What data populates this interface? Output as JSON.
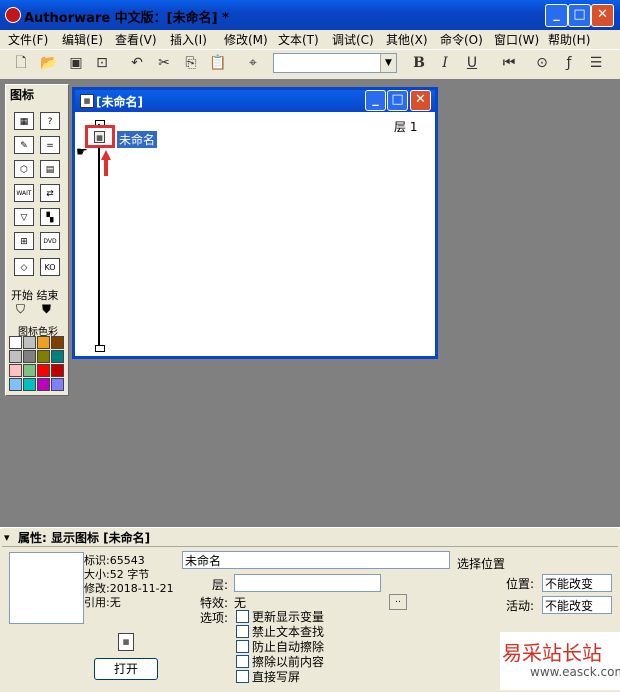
{
  "window": {
    "title": "Authorware 中文版：[未命名] *",
    "minimize": "_",
    "maximize": "□",
    "close": "✕"
  },
  "menu": [
    "文件(F)",
    "编辑(E)",
    "查看(V)",
    "插入(I)",
    "修改(M)",
    "文本(T)",
    "调试(C)",
    "其他(X)",
    "命令(O)",
    "窗口(W)",
    "帮助(H)"
  ],
  "toolbar": {
    "bold": "B",
    "italic": "I",
    "underline": "U",
    "style_value": ""
  },
  "palette": {
    "title": "图标",
    "start_end": "开始 结束",
    "color_label": "图标色彩",
    "colors": [
      "#ffffff",
      "#c0c0c0",
      "#f0a020",
      "#804000",
      "#c0c0c0",
      "#808080",
      "#808000",
      "#008080",
      "#ffc0c0",
      "#80c080",
      "#ff0000",
      "#c00000",
      "#80c0ff",
      "#00c0c0",
      "#c000c0",
      "#8080ff"
    ]
  },
  "flow_window": {
    "title": "[未命名]",
    "layer": "层 1",
    "icon_label": "未命名"
  },
  "properties": {
    "header": "属性: 显示图标 [未命名]",
    "id": "标识:65543",
    "size": "大小:52 字节",
    "modified": "修改:2018-11-21",
    "reference": "引用:无",
    "open_button": "打开",
    "name_value": "未命名",
    "select_position": "选择位置",
    "layer_label": "层:",
    "effect_label": "特效:",
    "effect_value": "无",
    "effect_button": "..",
    "options_label": "选项:",
    "options": [
      "更新显示变量",
      "禁止文本查找",
      "防止自动擦除",
      "擦除以前内容",
      "直接写屏"
    ],
    "position_label": "位置:",
    "position_value": "不能改变",
    "activity_label": "活动:",
    "activity_value": "不能改变"
  },
  "watermark": {
    "text": "易采站长站",
    "url": "www.easck.com"
  }
}
